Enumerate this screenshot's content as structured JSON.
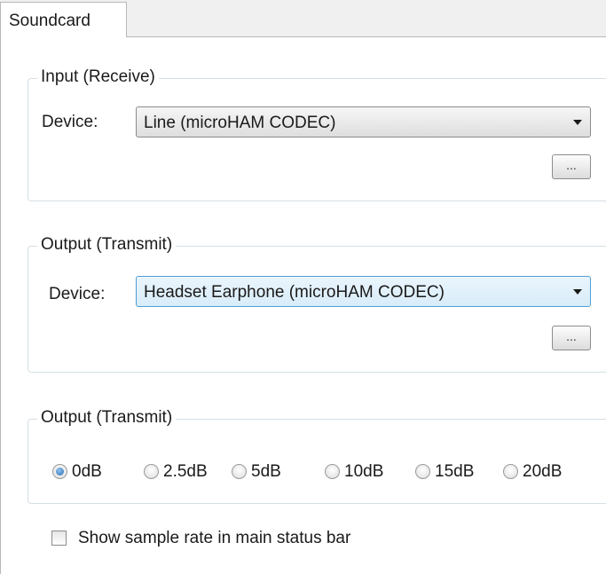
{
  "tabs": [
    {
      "label": "Soundcard"
    }
  ],
  "input_group": {
    "title": "Input (Receive)",
    "device_label": "Device:",
    "device_value": "Line (microHAM CODEC)",
    "browse_label": "..."
  },
  "output_group": {
    "title": "Output (Transmit)",
    "device_label": "Device:",
    "device_value": "Headset Earphone (microHAM CODEC)",
    "browse_label": "..."
  },
  "level_group": {
    "title": "Output (Transmit)",
    "options": [
      {
        "label": "0dB",
        "selected": true
      },
      {
        "label": "2.5dB",
        "selected": false
      },
      {
        "label": "5dB",
        "selected": false
      },
      {
        "label": "10dB",
        "selected": false
      },
      {
        "label": "15dB",
        "selected": false
      },
      {
        "label": "20dB",
        "selected": false
      }
    ]
  },
  "sample_rate_checkbox": {
    "label": "Show sample rate in main status bar",
    "checked": false
  }
}
